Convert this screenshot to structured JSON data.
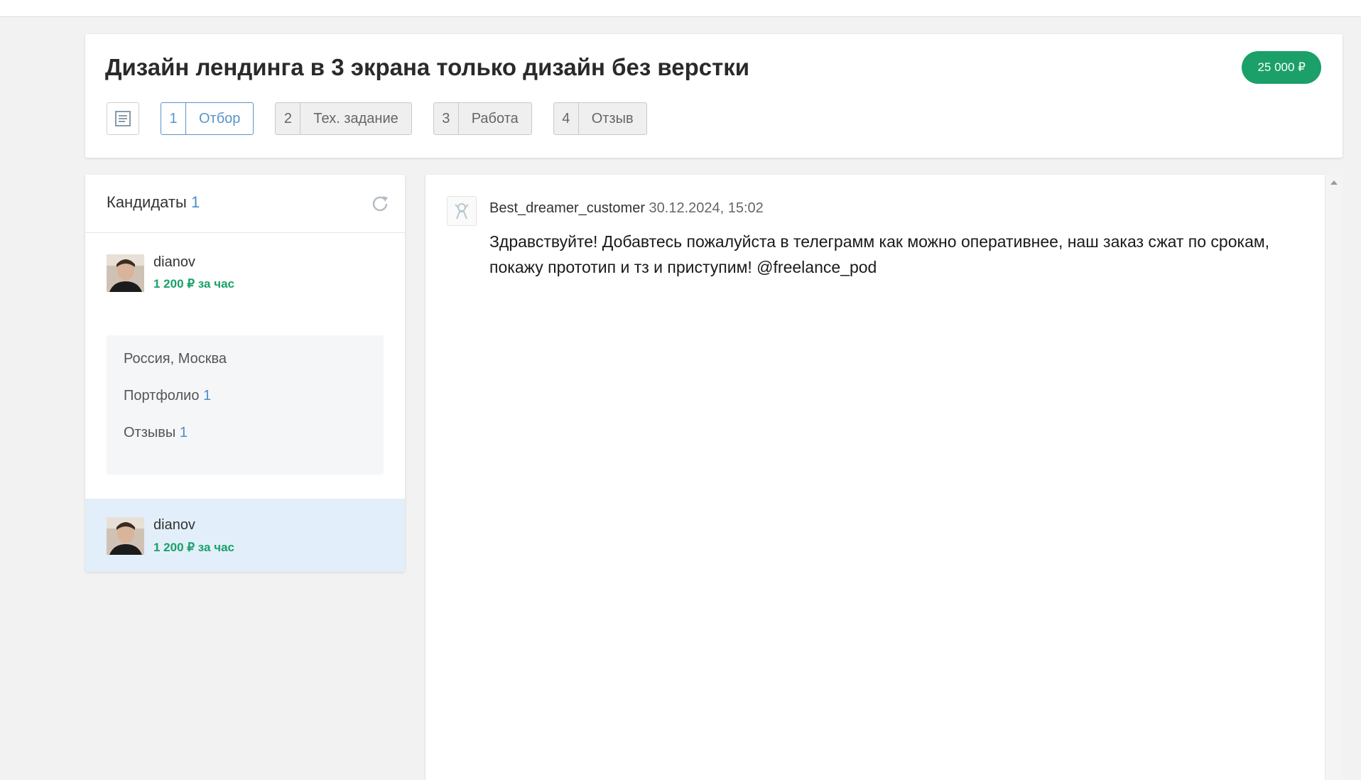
{
  "order": {
    "title": "Дизайн лендинга в 3 экрана только дизайн без верстки",
    "price": "25 000 ₽"
  },
  "steps": [
    {
      "number": "1",
      "label": "Отбор",
      "active": true
    },
    {
      "number": "2",
      "label": "Тех. задание",
      "active": false
    },
    {
      "number": "3",
      "label": "Работа",
      "active": false
    },
    {
      "number": "4",
      "label": "Отзыв",
      "active": false
    }
  ],
  "candidates": {
    "title": "Кандидаты",
    "count": "1",
    "items": [
      {
        "name": "dianov",
        "rate": "1 200 ₽ за час",
        "location": "Россия, Москва",
        "portfolio_label": "Портфолио",
        "portfolio_count": "1",
        "reviews_label": "Отзывы",
        "reviews_count": "1"
      },
      {
        "name": "dianov",
        "rate": "1 200 ₽ за час"
      }
    ]
  },
  "chat": {
    "messages": [
      {
        "author": "Best_dreamer_customer",
        "timestamp": "30.12.2024, 15:02",
        "text": "Здравствуйте! Добавтесь пожалуйста в телеграмм как можно оперативнее, наш заказ сжат по срокам, покажу прототип и тз и приступим! @freelance_pod"
      }
    ]
  },
  "icons": {
    "doc": "document-icon",
    "refresh": "refresh-icon",
    "scroll_up": "scroll-up-arrow-icon"
  },
  "colors": {
    "accent_green": "#1aa068",
    "accent_blue": "#4b8dc6",
    "selected_bg": "#e2effa"
  }
}
